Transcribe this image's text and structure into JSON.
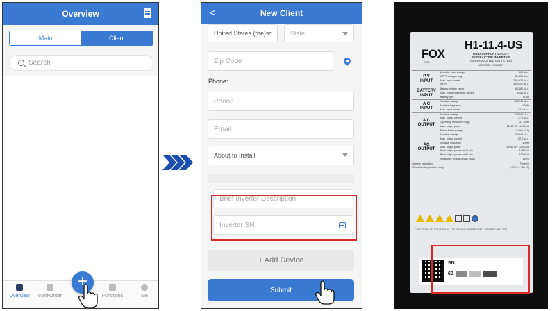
{
  "phone1": {
    "title": "Overview",
    "segments": {
      "main": "Main",
      "client": "Client"
    },
    "search_placeholder": "Search",
    "nav": [
      {
        "label": "Overview",
        "icon": "overview-icon"
      },
      {
        "label": "WorkOrder",
        "icon": "workorder-icon"
      },
      {
        "label": "Functions",
        "icon": "functions-icon"
      },
      {
        "label": "Me",
        "icon": "me-icon"
      }
    ],
    "fab_label": "+"
  },
  "phone2": {
    "title": "New Client",
    "back": "<",
    "country": "United States (the)",
    "state": "State",
    "zip_placeholder": "Zip Code",
    "phone_label": "Phone:",
    "phone_placeholder": "Phone",
    "email_placeholder": "Email",
    "status": "About to Install",
    "desc_placeholder": "Brief Inverter Description",
    "sn_placeholder": "Inverter SN",
    "add_device": "+  Add Device",
    "submit": "Submit"
  },
  "photo": {
    "brand": "FOX",
    "brand_sub": "ESS",
    "model": "H1-11.4-US",
    "model_sub_1": "GRID SUPPORT UTILITY",
    "model_sub_2": "INTERACTIVE INVERTER",
    "model_sub_3": "(NON-ISOLATED INVERTER)",
    "model_sub_4": "www.fox-ess.com",
    "sections": [
      {
        "head": "P V\nINPUT",
        "lines": [
          [
            "Absolute max. voltage",
            "600 Va.c."
          ],
          [
            "MPPT voltage range",
            "80-550 Va.c."
          ],
          [
            "Max. input current",
            "28/14/14 Ad.c."
          ],
          [
            "Isc PV",
            "44/22/22 Ad.c."
          ]
        ]
      },
      {
        "head": "BATTERY\nINPUT",
        "lines": [
          [
            "Battery voltage range",
            "85-480 Va.c."
          ],
          [
            "Max. charge/discharge current",
            "50/50 Ad.c."
          ],
          [
            "Battery type",
            "Li-ion"
          ]
        ]
      },
      {
        "head": "A C\nINPUT",
        "lines": [
          [
            "Nominal voltage",
            "120/240 Va.c."
          ],
          [
            "Nominal frequency",
            "60 Hz"
          ],
          [
            "Max. input current",
            "47.5 Aa.c."
          ]
        ]
      },
      {
        "head": "A C\nOUTPUT",
        "lines": [
          [
            "Nominal voltage",
            "120/240 Va.c."
          ],
          [
            "Max. output current",
            "47.5 Aa.c."
          ],
          [
            "Operating frequency range",
            "57-63Hz"
          ],
          [
            "Max. output power",
            "11400 W / 11400 VA"
          ],
          [
            "Power factor (range)",
            "~0.8ind.+0.8)"
          ]
        ]
      },
      {
        "head": "AC\nOUTPUT",
        "lines": [
          [
            "Nominal voltage",
            "120/240 Va.c."
          ],
          [
            "Max. output current",
            "52.3 Aa.c."
          ],
          [
            "Nominal frequency",
            "60 Hz"
          ],
          [
            "Max. output power",
            "12540 W / 12540 VA"
          ],
          [
            "Peak output power for 10 min.",
            "13860 W"
          ],
          [
            "Peak output power for 60 sec.",
            "16390 W"
          ],
          [
            "Imbalance for split-phase loads",
            "100%"
          ]
        ]
      }
    ],
    "ingress": [
      "Ingress protection",
      "Type 4X"
    ],
    "temp": [
      "Operation temperature range",
      "(-25 °C....+60 °C)"
    ],
    "cert": "CSA C22.2 No.107.1-16  UL Std No. 1741  IEEE1547-2018  IEEE1547.1-2020  IEEE1547a-2020",
    "sn_label": "SN:",
    "sn_value": "60"
  },
  "colors": {
    "accent": "#3a7ad2",
    "highlight": "#d62a2a",
    "arrow": "#1a4fb0"
  }
}
